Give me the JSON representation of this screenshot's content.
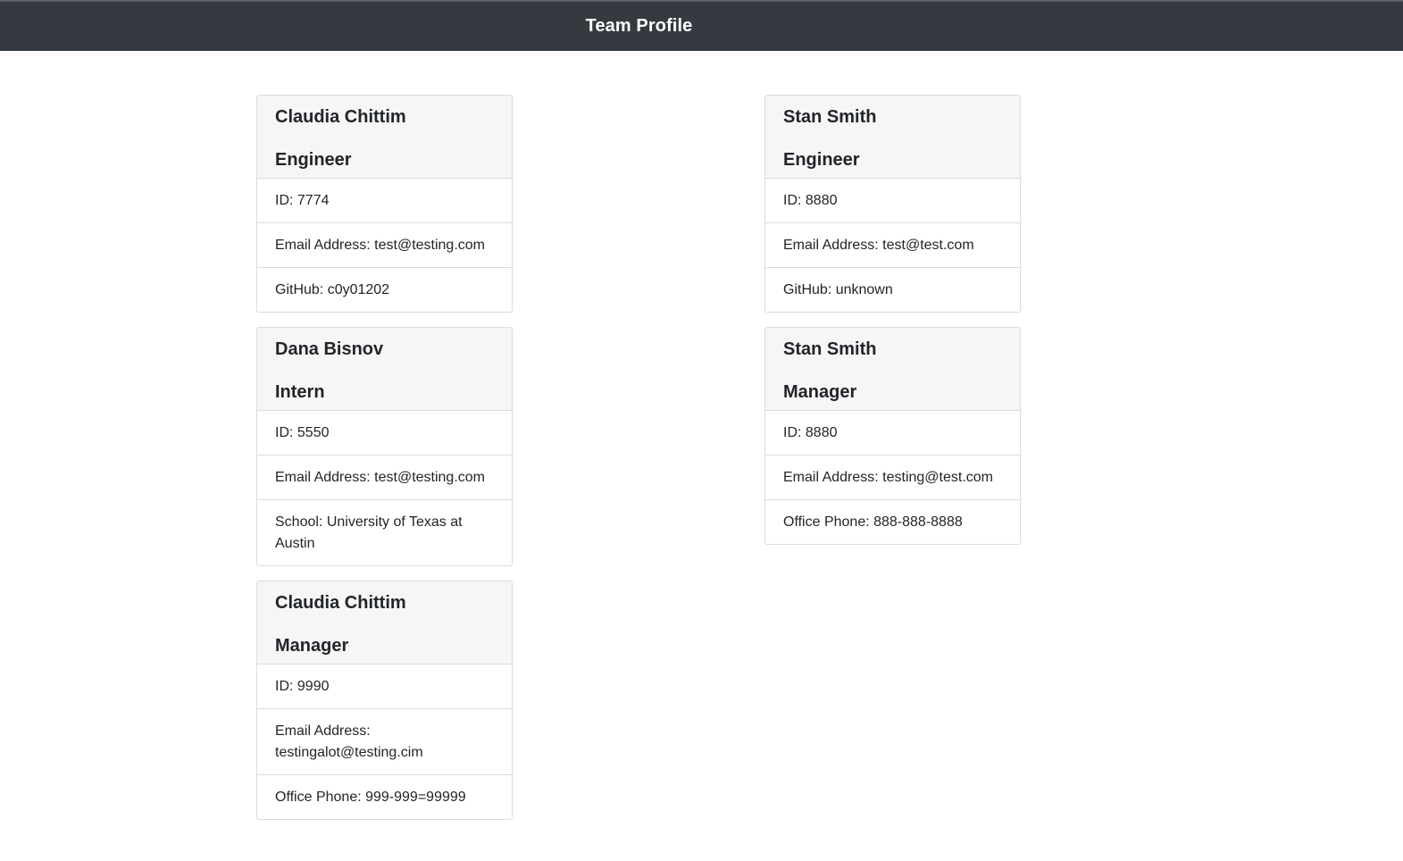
{
  "header": {
    "title": "Team Profile"
  },
  "columns": {
    "left": [
      {
        "name": "Claudia Chittim",
        "role": "Engineer",
        "rows": [
          "ID: 7774",
          "Email Address: test@testing.com",
          "GitHub: c0y01202"
        ]
      },
      {
        "name": "Dana Bisnov",
        "role": "Intern",
        "rows": [
          "ID: 5550",
          "Email Address: test@testing.com",
          "School: University of Texas at Austin"
        ]
      },
      {
        "name": "Claudia Chittim",
        "role": "Manager",
        "rows": [
          "ID: 9990",
          "Email Address: testingalot@testing.cim",
          "Office Phone: 999-999=99999"
        ]
      }
    ],
    "right": [
      {
        "name": "Stan Smith",
        "role": "Engineer",
        "rows": [
          "ID: 8880",
          "Email Address: test@test.com",
          "GitHub: unknown"
        ]
      },
      {
        "name": "Stan Smith",
        "role": "Manager",
        "rows": [
          "ID: 8880",
          "Email Address: testing@test.com",
          "Office Phone: 888-888-8888"
        ]
      }
    ]
  },
  "colors": {
    "navbar": "#343a40",
    "card_header": "#f6f6f6",
    "border": "#dcdcdc"
  }
}
